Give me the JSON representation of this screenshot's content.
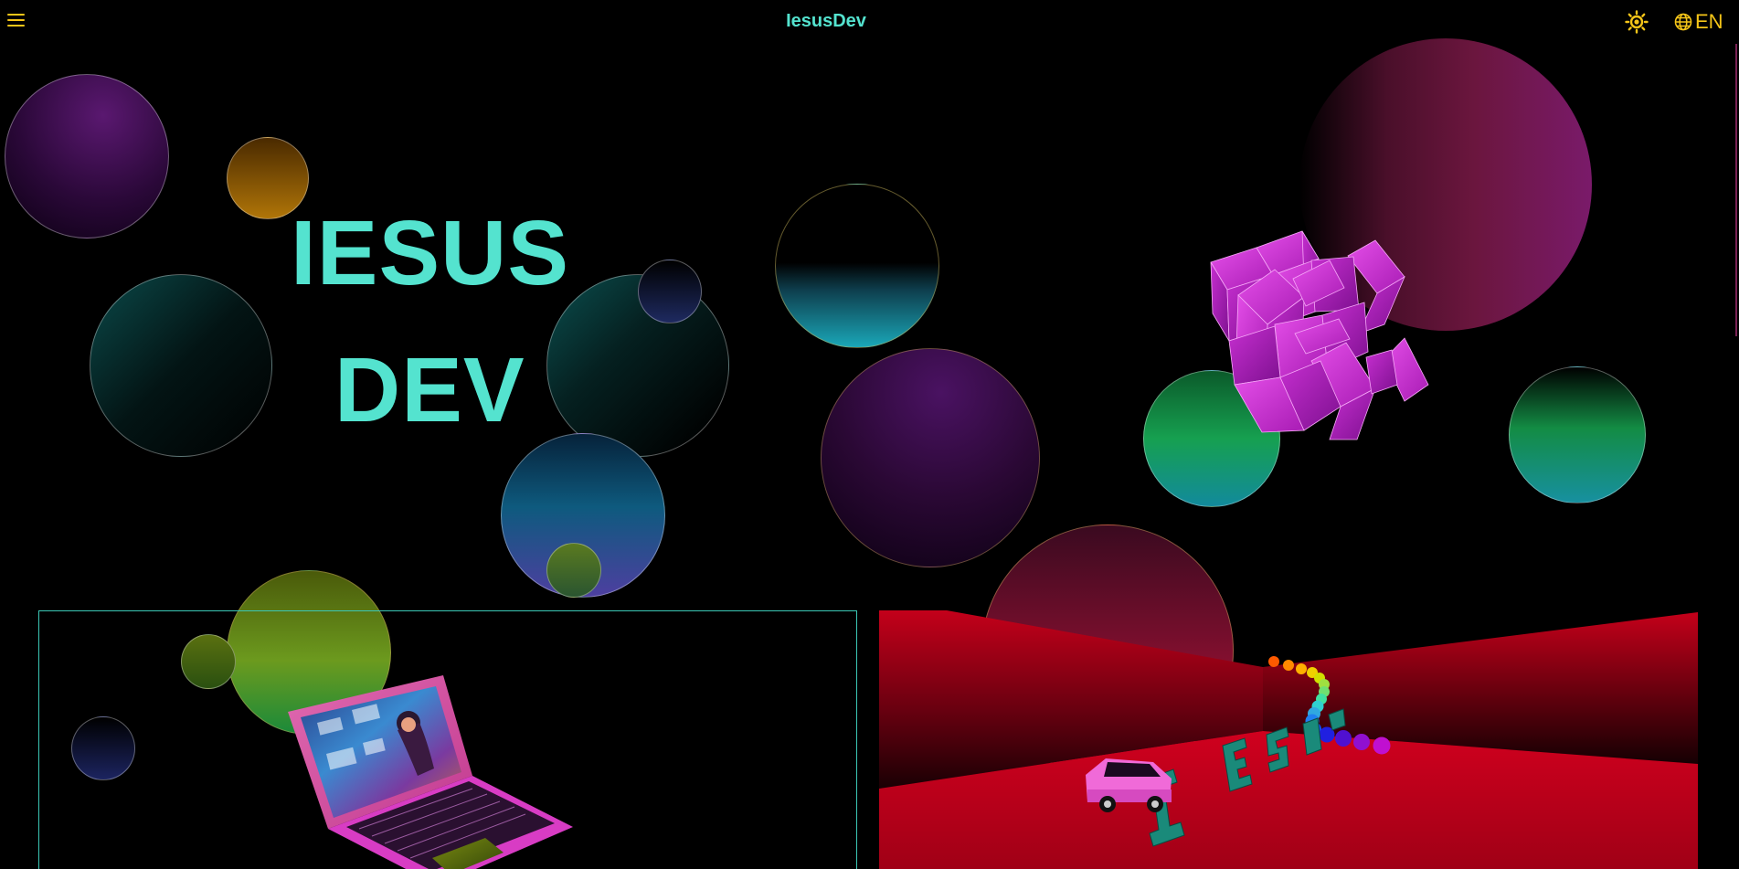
{
  "header": {
    "menu_icon": "hamburger-menu-icon",
    "brand": "IesusDev",
    "theme_icon": "sun-icon",
    "language_icon": "globe-icon",
    "language": "EN"
  },
  "hero": {
    "line1": "IESUS",
    "line2": "DEV"
  },
  "scene_left": {
    "object": "laptop-illustration"
  },
  "scene_right": {
    "letters": "IESUS",
    "object": "car-illustration"
  },
  "colors": {
    "accent": "#54e3cf",
    "icon": "#f5c518",
    "magenta": "#d12fd6",
    "red_floor": "#d0001e"
  }
}
